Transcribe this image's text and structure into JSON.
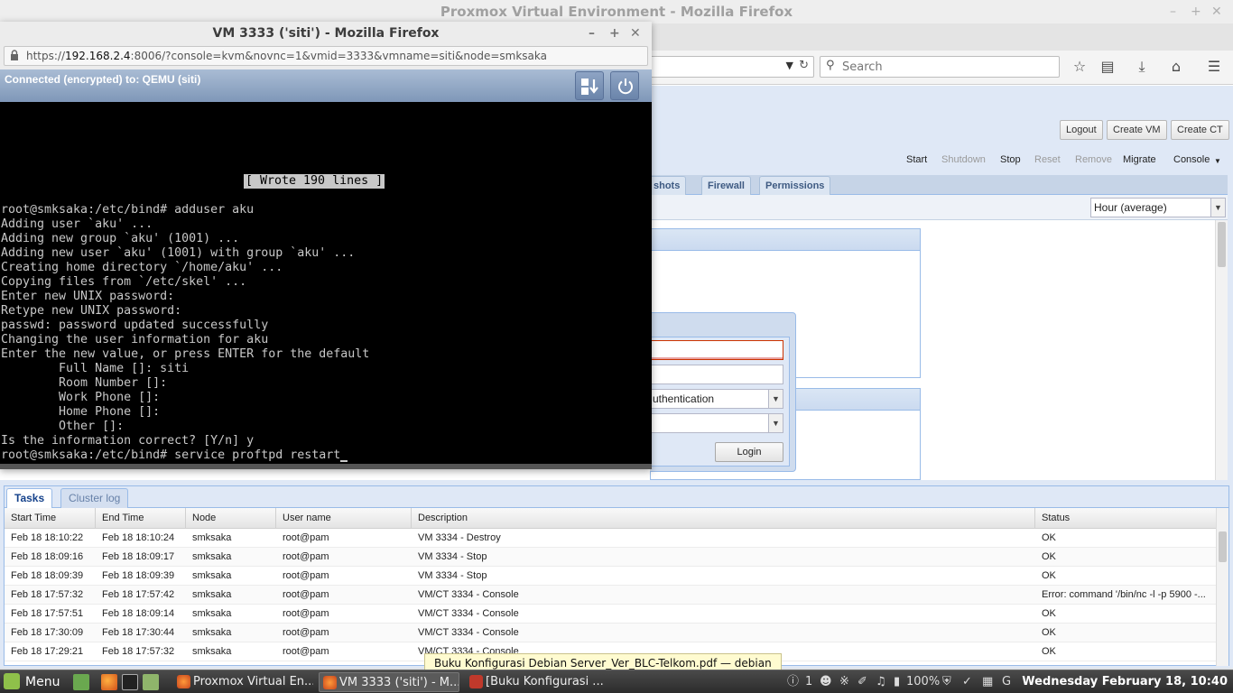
{
  "background_window": {
    "title": "Proxmox Virtual Environment - Mozilla Firefox",
    "search_placeholder": "Search"
  },
  "pve": {
    "header_buttons": [
      "Logout",
      "Create VM",
      "Create CT"
    ],
    "vm_toolbar": {
      "start": "Start",
      "shutdown": "Shutdown",
      "stop": "Stop",
      "reset": "Reset",
      "remove": "Remove",
      "migrate": "Migrate",
      "console": "Console"
    },
    "vm_tabs": [
      "shots",
      "Firewall",
      "Permissions"
    ],
    "timeframe": "Hour (average)",
    "login": {
      "realm_fragment": "uthentication",
      "login_button": "Login"
    },
    "tasks": {
      "tabs": [
        "Tasks",
        "Cluster log"
      ],
      "columns": [
        "Start Time",
        "End Time",
        "Node",
        "User name",
        "Description",
        "Status"
      ],
      "rows": [
        [
          "Feb 18 18:10:22",
          "Feb 18 18:10:24",
          "smksaka",
          "root@pam",
          "VM 3334 - Destroy",
          "OK"
        ],
        [
          "Feb 18 18:09:16",
          "Feb 18 18:09:17",
          "smksaka",
          "root@pam",
          "VM 3334 - Stop",
          "OK"
        ],
        [
          "Feb 18 18:09:39",
          "Feb 18 18:09:39",
          "smksaka",
          "root@pam",
          "VM 3334 - Stop",
          "OK"
        ],
        [
          "Feb 18 17:57:32",
          "Feb 18 17:57:42",
          "smksaka",
          "root@pam",
          "VM/CT 3334 - Console",
          "Error: command '/bin/nc -l -p 5900 -..."
        ],
        [
          "Feb 18 17:57:51",
          "Feb 18 18:09:14",
          "smksaka",
          "root@pam",
          "VM/CT 3334 - Console",
          "OK"
        ],
        [
          "Feb 18 17:30:09",
          "Feb 18 17:30:44",
          "smksaka",
          "root@pam",
          "VM/CT 3334 - Console",
          "OK"
        ],
        [
          "Feb 18 17:29:21",
          "Feb 18 17:57:32",
          "smksaka",
          "root@pam",
          "VM/CT 3334 - Console",
          "OK"
        ]
      ]
    }
  },
  "popup": {
    "title": "VM 3333 ('siti') - Mozilla Firefox",
    "url_prefix": "https://",
    "url_host": "192.168.2.4",
    "url_rest": ":8006/?console=kvm&novnc=1&vmid=3333&vmname=siti&node=smksaka",
    "status": "Connected (encrypted) to: QEMU (siti)",
    "wrote_banner": "[ Wrote 190 lines ]",
    "terminal_lines": [
      "root@smksaka:/etc/bind# adduser aku",
      "Adding user `aku' ...",
      "Adding new group `aku' (1001) ...",
      "Adding new user `aku' (1001) with group `aku' ...",
      "Creating home directory `/home/aku' ...",
      "Copying files from `/etc/skel' ...",
      "Enter new UNIX password:",
      "Retype new UNIX password:",
      "passwd: password updated successfully",
      "Changing the user information for aku",
      "Enter the new value, or press ENTER for the default",
      "        Full Name []: siti",
      "        Room Number []:",
      "        Work Phone []:",
      "        Home Phone []:",
      "        Other []:",
      "Is the information correct? [Y/n] y",
      "root@smksaka:/etc/bind# service proftpd restart"
    ]
  },
  "tooltip": "Buku Konfigurasi Debian Server_Ver_BLC-Telkom.pdf — debian",
  "taskbar": {
    "menu": "Menu",
    "tasks": [
      "Proxmox Virtual En...",
      "VM 3333 ('siti') - M...",
      "[Buku Konfigurasi ..."
    ],
    "tray_count": "1",
    "battery": "100%",
    "clock": "Wednesday February 18, 10:40"
  },
  "colors": {
    "pve_accent": "#15428b",
    "panel_border": "#99bbe8",
    "terminal_bg": "#000000",
    "terminal_fg": "#c8c8c8",
    "tooltip_bg": "#fffbd0",
    "mint_green": "#8fc04a"
  }
}
